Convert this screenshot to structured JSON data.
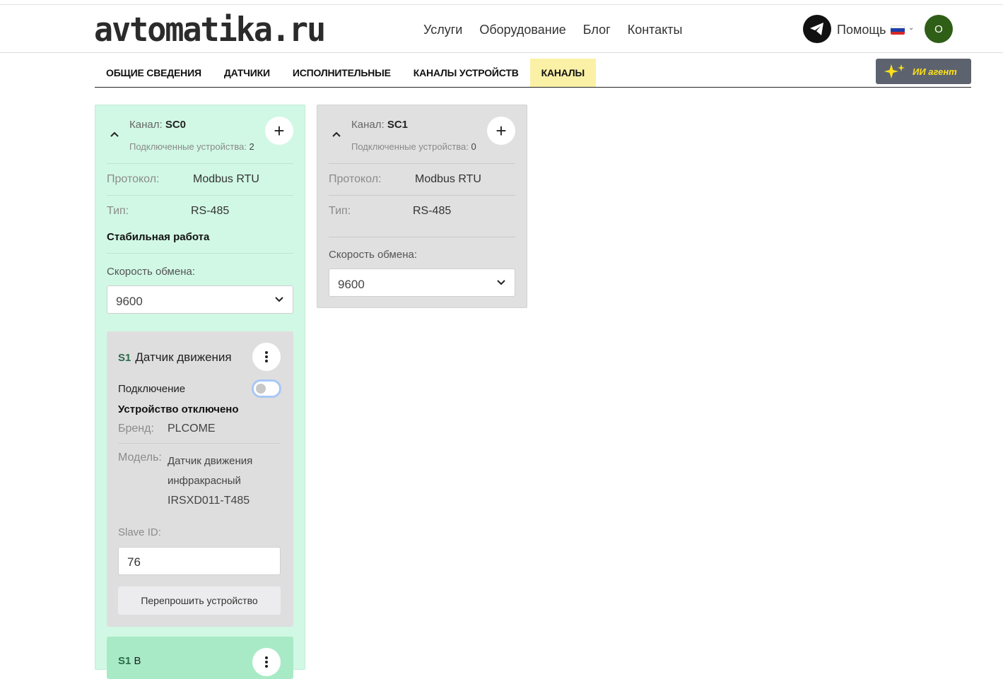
{
  "header": {
    "logo": "avtomatika.ru",
    "nav": [
      "Услуги",
      "Оборудование",
      "Блог",
      "Контакты"
    ],
    "help_label": "Помощь",
    "avatar_letter": "O",
    "telegram_icon": "telegram-icon",
    "language": "ru"
  },
  "tabs": [
    {
      "label": "ОБЩИЕ СВЕДЕНИЯ",
      "active": false
    },
    {
      "label": "ДАТЧИКИ",
      "active": false
    },
    {
      "label": "ИСПОЛНИТЕЛЬНЫЕ",
      "active": false
    },
    {
      "label": "КАНАЛЫ УСТРОЙСТВ",
      "active": false
    },
    {
      "label": "КАНАЛЫ",
      "active": true
    }
  ],
  "ai_button": {
    "label": "ИИ агент",
    "color": "#ffe11a"
  },
  "channels": [
    {
      "title_prefix": "Канал:",
      "name": "SC0",
      "connected_label": "Подключенные устройства:",
      "connected_count": "2",
      "protocol_label": "Протокол:",
      "protocol": "Modbus RTU",
      "type_label": "Тип:",
      "type": "RS-485",
      "status": "Стабильная работа",
      "speed_label": "Скорость обмена:",
      "speed": "9600",
      "color": "#d1f8e5",
      "devices": [
        {
          "code": "S1",
          "name": "Датчик движения",
          "connection_label": "Подключение",
          "connected": false,
          "state": "Устройство отключено",
          "brand_label": "Бренд:",
          "brand": "PLCOME",
          "model_label": "Модель:",
          "model_lines": [
            "Датчик движения",
            "инфракрасный",
            "IRSXD011-T485"
          ],
          "slave_label": "Slave ID:",
          "slave_id": "76",
          "flash_label": "Перепрошить устройство"
        },
        {
          "code": "S1",
          "name": "В"
        }
      ]
    },
    {
      "title_prefix": "Канал:",
      "name": "SC1",
      "connected_label": "Подключенные устройства:",
      "connected_count": "0",
      "protocol_label": "Протокол:",
      "protocol": "Modbus RTU",
      "type_label": "Тип:",
      "type": "RS-485",
      "speed_label": "Скорость обмена:",
      "speed": "9600",
      "color": "#e0e0e0"
    }
  ]
}
